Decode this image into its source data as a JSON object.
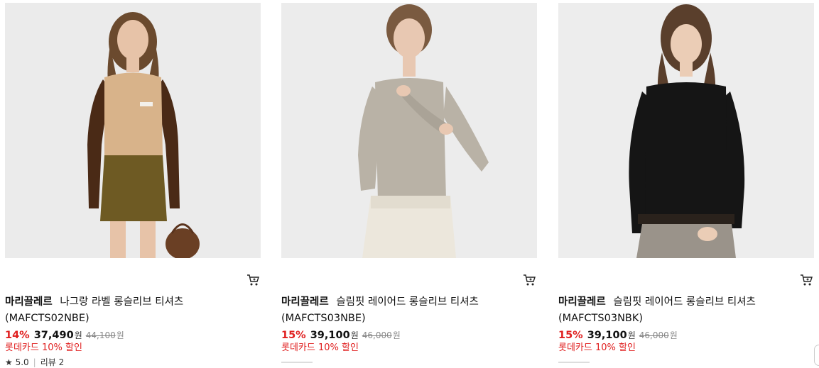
{
  "products": [
    {
      "brand": "마리끌레르",
      "name": "나그랑 라벨 롱슬리브 티셔츠",
      "model": "(MAFCTS02NBE)",
      "discount_rate": "14%",
      "price": "37,490",
      "price_unit": "원",
      "original_price": "44,100",
      "original_unit": "원",
      "promo": "롯데카드 10% 할인",
      "rating": "★ 5.0",
      "reviews": "리뷰 2",
      "colors": {
        "top_body": "#d8b38a",
        "sleeve": "#4a2a16",
        "skirt": "#6e5a23",
        "hair": "#6b4a2e",
        "skin": "#e7c3a8"
      }
    },
    {
      "brand": "마리끌레르",
      "name": "슬림핏 레이어드 롱슬리브 티셔츠",
      "model": "(MAFCTS03NBE)",
      "discount_rate": "15%",
      "price": "39,100",
      "price_unit": "원",
      "original_price": "46,000",
      "original_unit": "원",
      "promo": "롯데카드 10% 할인",
      "colors": {
        "top_body": "#b9b2a6",
        "pants": "#ece7dc",
        "hair": "#7a5a40",
        "skin": "#e8c8b2"
      }
    },
    {
      "brand": "마리끌레르",
      "name": "슬림핏 레이어드 롱슬리브 티셔츠",
      "model": "(MAFCTS03NBK)",
      "discount_rate": "15%",
      "price": "39,100",
      "price_unit": "원",
      "original_price": "46,000",
      "original_unit": "원",
      "promo": "롯데카드 10% 할인",
      "colors": {
        "top_body": "#151515",
        "pants": "#9a938a",
        "hair": "#5a3f2c",
        "skin": "#ebcdb6"
      }
    }
  ],
  "icons": {
    "cart": "cart-icon"
  }
}
